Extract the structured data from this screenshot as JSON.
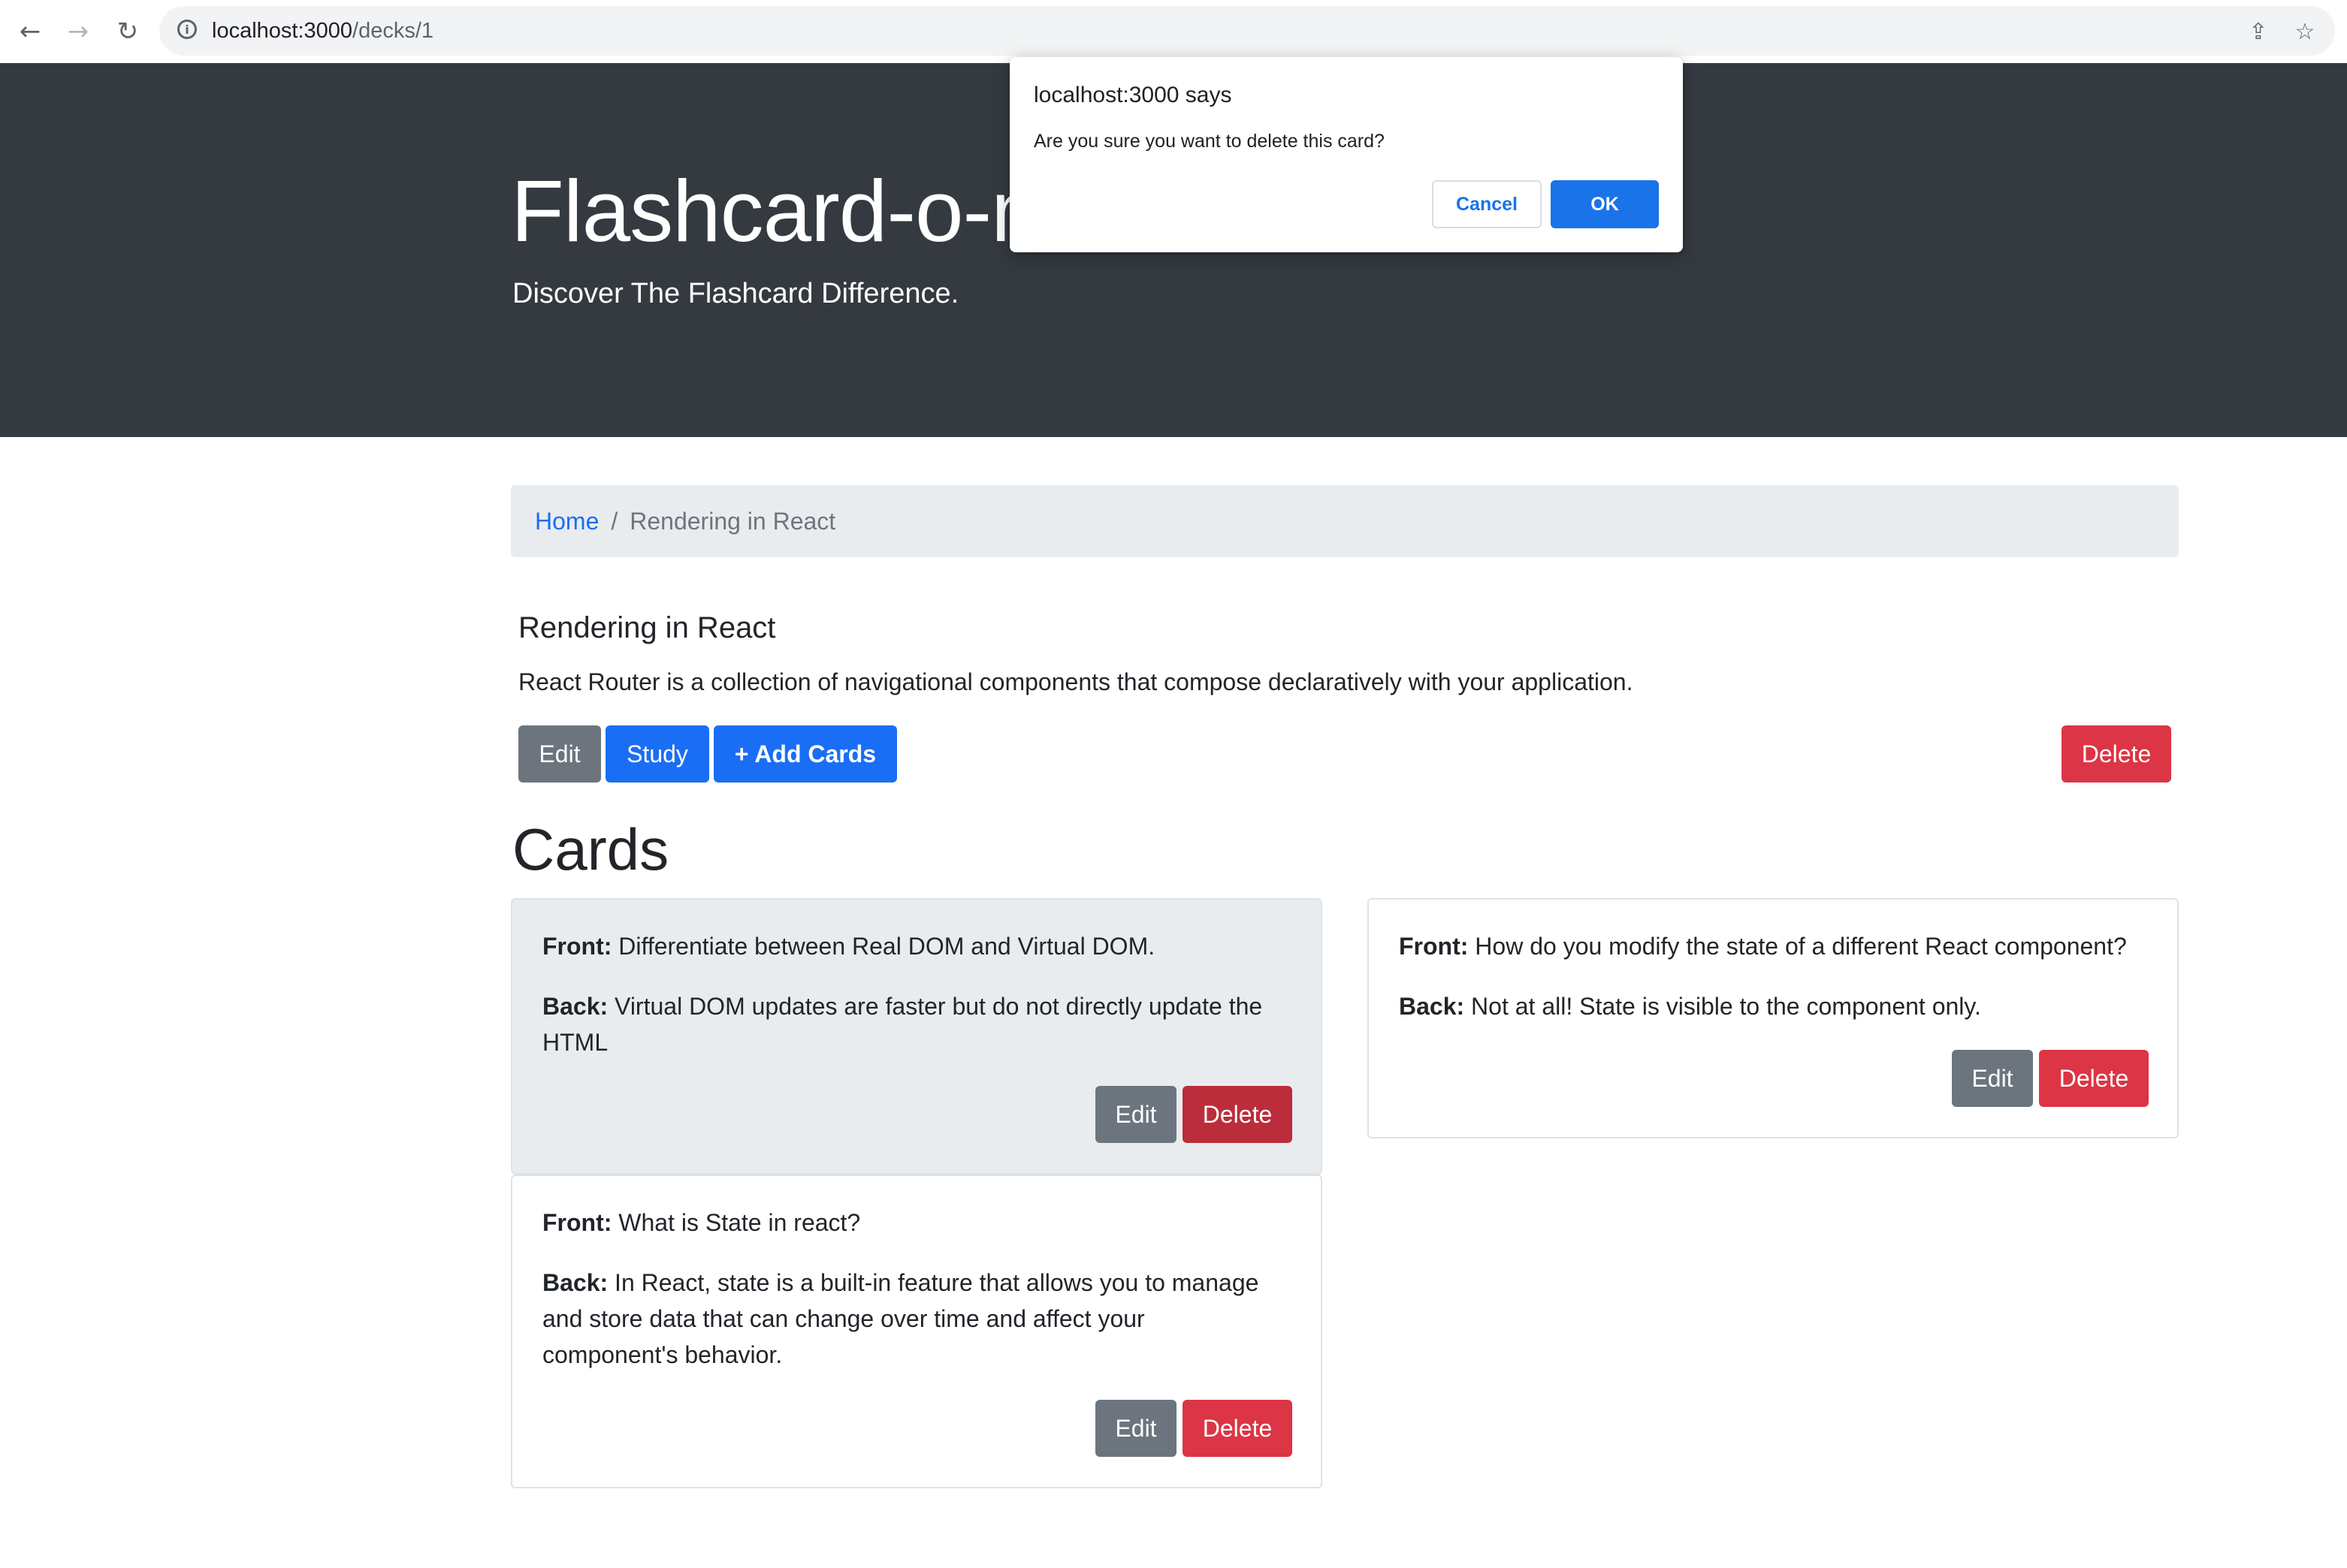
{
  "browser": {
    "url_host": "localhost:3000",
    "url_path": "/decks/1",
    "back_icon": "←",
    "forward_icon": "→",
    "reload_icon": "↻",
    "info_icon": "i",
    "share_icon": "⇪",
    "star_icon": "☆"
  },
  "header": {
    "title": "Flashcard-o-m",
    "tagline": "Discover The Flashcard Difference."
  },
  "breadcrumb": {
    "home": "Home",
    "separator": "/",
    "current": "Rendering in React"
  },
  "deck": {
    "name": "Rendering in React",
    "description": "React Router is a collection of navigational components that compose declaratively with your application.",
    "edit_label": "Edit",
    "study_label": "Study",
    "add_cards_label": "+ Add Cards",
    "delete_label": "Delete"
  },
  "cards_heading": "Cards",
  "cards": [
    {
      "front_label": "Front:",
      "front": "Differentiate between Real DOM and Virtual DOM.",
      "back_label": "Back:",
      "back_line1": "Virtual DOM updates are faster but do not directly update the",
      "back_line2": "HTML",
      "edit_label": "Edit",
      "delete_label": "Delete"
    },
    {
      "front_label": "Front:",
      "front": "How do you modify the state of a different React component?",
      "back_label": "Back:",
      "back_line1": "Not at all! State is visible to the component only.",
      "edit_label": "Edit",
      "delete_label": "Delete"
    },
    {
      "front_label": "Front:",
      "front": "What is State in react?",
      "back_label": "Back:",
      "back_line1": "In React, state is a built-in feature that allows you to manage",
      "back_line2": "and store data that can change over time and affect your",
      "back_line3": "component's behavior.",
      "edit_label": "Edit",
      "delete_label": "Delete"
    }
  ],
  "dialog": {
    "title": "localhost:3000 says",
    "message": "Are you sure you want to delete this card?",
    "cancel_label": "Cancel",
    "ok_label": "OK"
  },
  "colors": {
    "jumbotron": "#343a40",
    "primary": "#1a6ef5",
    "secondary": "#6c757d",
    "danger": "#dc3545",
    "breadcrumb_bg": "#e9ecef"
  }
}
